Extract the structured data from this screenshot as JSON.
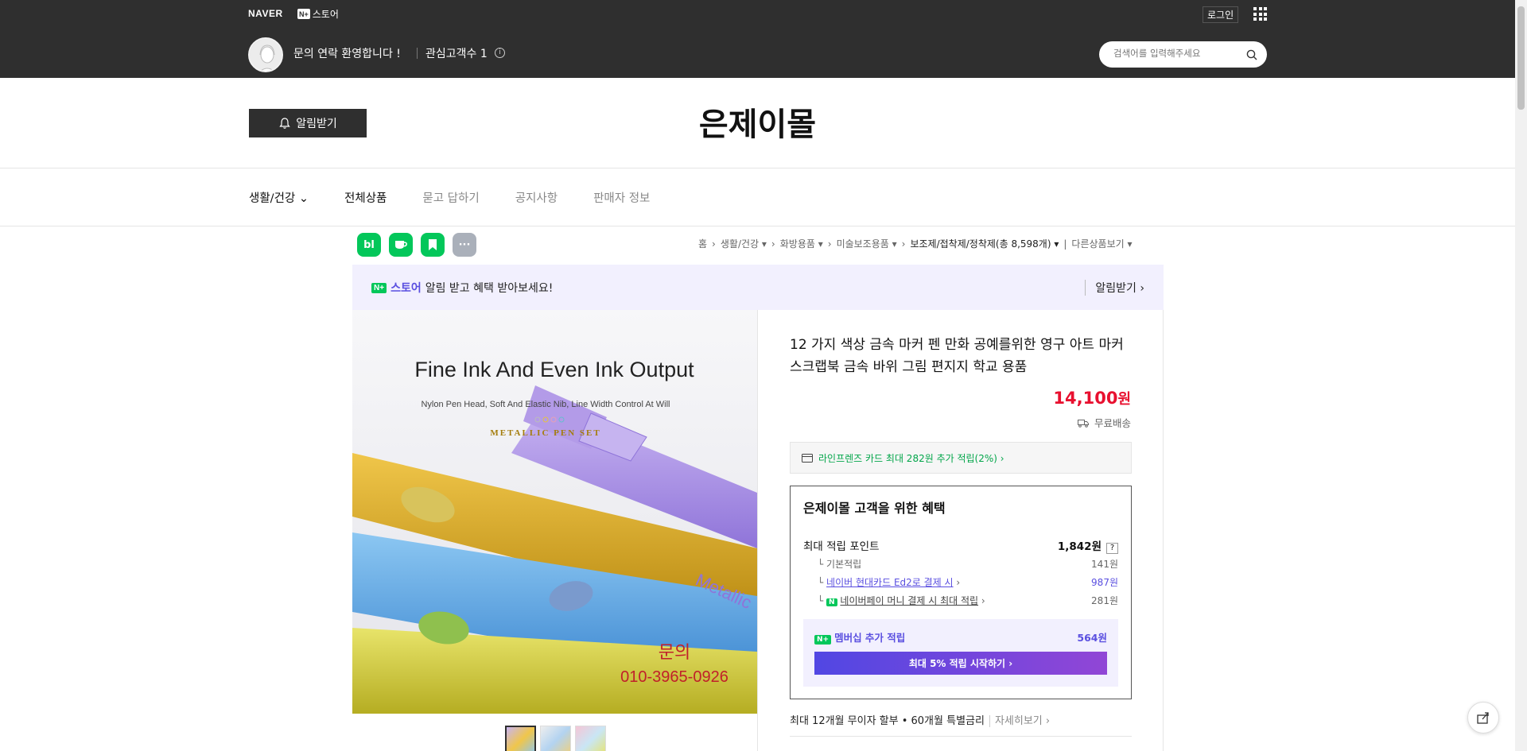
{
  "gnb": {
    "naver": "NAVER",
    "store_badge": "N+",
    "store": "스토어",
    "login": "로그인"
  },
  "profile": {
    "welcome": "문의 연락 환영합니다 !",
    "fav": "관심고객수 1"
  },
  "search": {
    "placeholder": "검색어를 입력해주세요"
  },
  "store": {
    "alarm_label": "알림받기",
    "name": "은제이몰"
  },
  "nav": [
    "생활/건강",
    "전체상품",
    "묻고 답하기",
    "공지사항",
    "판매자 정보"
  ],
  "sns": [
    "bl",
    "cafe",
    "bookmark",
    "more"
  ],
  "breadcrumb": [
    "홈",
    "생활/건강",
    "화방용품",
    "미술보조용품",
    "보조제/접착제/정착제(총 8,598개)",
    "다른상품보기"
  ],
  "banner": {
    "badge": "N+",
    "store": "스토어",
    "text": "알림 받고 혜택 받아보세요!",
    "right": "알림받기"
  },
  "product_image": {
    "headline": "Fine Ink And Even Ink Output",
    "subline": "Nylon Pen Head, Soft And Elastic Nib, Line Width Control At Will",
    "brand": "METALLIC PEN SET",
    "watermark_name": "문의",
    "watermark_phone": "010-3965-0926",
    "pen_label": "Metallic"
  },
  "product": {
    "title": "12 가지 색상 금속 마커 펜 만화 공예를위한 영구 아트 마커 스크랩북 금속 바위 그림 편지지 학교 용품",
    "price": "14,100",
    "price_unit": "원",
    "shipping": "무료배송",
    "card_benefit": "라인프렌즈 카드 최대 282원 추가 적립(2%)"
  },
  "benefit": {
    "title": "은제이몰 고객을 위한 혜택",
    "max_label": "최대 적립 포인트",
    "max_value": "1,842원",
    "rows": [
      {
        "label": "기본적립",
        "value": "141원"
      },
      {
        "label": "네이버 현대카드 Ed2로 결제 시",
        "value": "987원"
      },
      {
        "label": "네이버페이 머니 결제 시 최대 적립",
        "value": "281원"
      }
    ],
    "membership_label": "멤버십 추가 적립",
    "membership_value": "564원",
    "membership_button": "최대 5% 적립 시작하기"
  },
  "installment": {
    "text": "최대 12개월 무이자 할부 • 60개월 특별금리",
    "link": "자세히보기"
  },
  "colors": {
    "topbar": "#2f2f2f",
    "price": "#e8102f",
    "accent_purple": "#5a4fe0",
    "naver_green": "#03c75a"
  }
}
